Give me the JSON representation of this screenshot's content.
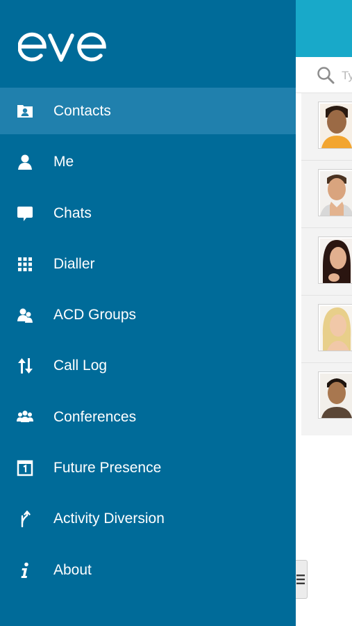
{
  "brand": {
    "logo_text": "eve"
  },
  "search": {
    "placeholder": "Type"
  },
  "sidebar": {
    "items": [
      {
        "label": "Contacts",
        "icon": "contacts-icon",
        "active": true
      },
      {
        "label": "Me",
        "icon": "person-icon"
      },
      {
        "label": "Chats",
        "icon": "chat-bubble-icon"
      },
      {
        "label": "Dialler",
        "icon": "keypad-icon"
      },
      {
        "label": "ACD Groups",
        "icon": "group-icon"
      },
      {
        "label": "Call Log",
        "icon": "up-down-arrows-icon"
      },
      {
        "label": "Conferences",
        "icon": "conference-icon"
      },
      {
        "label": "Future Presence",
        "icon": "calendar-icon"
      },
      {
        "label": "Activity Diversion",
        "icon": "diversion-icon"
      },
      {
        "label": "About",
        "icon": "info-icon"
      }
    ]
  },
  "contacts": {
    "avatars": [
      "avatar-1",
      "avatar-2",
      "avatar-3",
      "avatar-4",
      "avatar-5"
    ]
  },
  "colors": {
    "drawer": "#006b99",
    "active_item": "#2080ad",
    "header": "#18a9c9"
  }
}
